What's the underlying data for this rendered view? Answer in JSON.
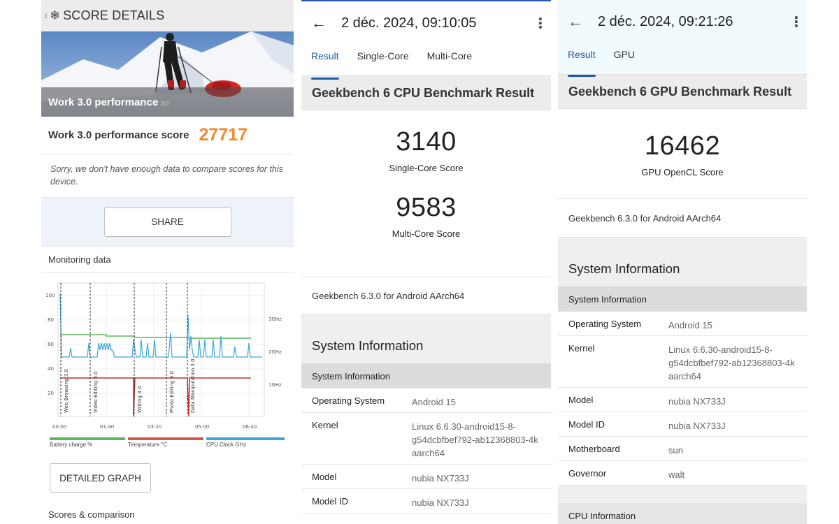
{
  "pcmark": {
    "header_title": "SCORE DETAILS",
    "hero_title": "Work 3.0 performance",
    "hero_version": "3.0",
    "score_label": "Work 3.0 performance score",
    "score_value": "27717",
    "note": "Sorry, we don't have enough data to compare scores for this device.",
    "share_label": "SHARE",
    "monitoring_label": "Monitoring data",
    "chart": {
      "y_ticks": [
        "100",
        "80",
        "60",
        "40",
        "20"
      ],
      "right_ticks": [
        "3GHz",
        "2GHz",
        "1GHz"
      ],
      "x_ticks": [
        "00:00",
        "01:40",
        "03:20",
        "05:00",
        "06:40"
      ],
      "markers": [
        "Web Browsing 3.0",
        "Video Editing 3.0",
        "Writing 3.0",
        "Photo Editing 3.0",
        "Data Manipulation 3.0"
      ]
    },
    "legend": [
      {
        "label": "Battery charge %",
        "color": "#5cb85c"
      },
      {
        "label": "Temperature °C",
        "color": "#d9534f"
      },
      {
        "label": "CPU Clock GHz",
        "color": "#3aa8dc"
      }
    ],
    "detailed_graph_label": "DETAILED GRAPH",
    "scores_comparison_label": "Scores & comparison"
  },
  "cpu": {
    "date": "2 déc. 2024, 09:10:05",
    "tabs": [
      "Result",
      "Single-Core",
      "Multi-Core"
    ],
    "section_title": "Geekbench 6 CPU Benchmark Result",
    "single_score": "3140",
    "single_label": "Single-Core Score",
    "multi_score": "9583",
    "multi_label": "Multi-Core Score",
    "version": "Geekbench 6.3.0 for Android AArch64",
    "system_info_title": "System Information",
    "subheader": "System Information",
    "rows": [
      {
        "key": "Operating System",
        "value": "Android 15"
      },
      {
        "key": "Kernel",
        "value": "Linux 6.6.30-android15-8-g54dcbfbef792-ab12368803-4k aarch64"
      },
      {
        "key": "Model",
        "value": "nubia NX733J"
      },
      {
        "key": "Model ID",
        "value": "nubia NX733J"
      }
    ]
  },
  "gpu": {
    "date": "2 déc. 2024, 09:21:26",
    "tabs": [
      "Result",
      "GPU"
    ],
    "section_title": "Geekbench 6 GPU Benchmark Result",
    "score": "16462",
    "score_label": "GPU OpenCL Score",
    "version": "Geekbench 6.3.0 for Android AArch64",
    "system_info_title": "System Information",
    "subheader": "System Information",
    "rows": [
      {
        "key": "Operating System",
        "value": "Android 15"
      },
      {
        "key": "Kernel",
        "value": "Linux 6.6.30-android15-8-g54dcbfbef792-ab12368803-4k aarch64"
      },
      {
        "key": "Model",
        "value": "nubia NX733J"
      },
      {
        "key": "Model ID",
        "value": "nubia NX733J"
      },
      {
        "key": "Motherboard",
        "value": "sun"
      },
      {
        "key": "Governor",
        "value": "walt"
      }
    ],
    "cpu_info_label": "CPU Information"
  }
}
